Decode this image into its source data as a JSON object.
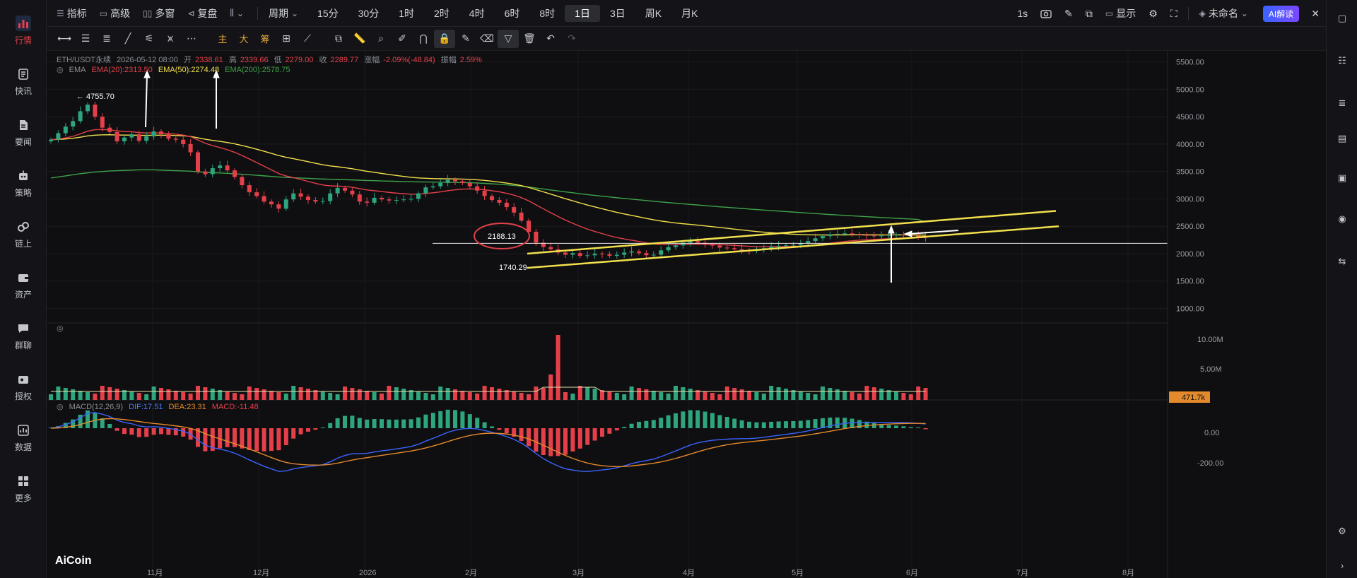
{
  "toolbar": {
    "indicators": "指标",
    "advanced": "高级",
    "multi_window": "多窗",
    "replay": "复盘",
    "period": "周期",
    "periods": [
      "15分",
      "30分",
      "1时",
      "2时",
      "4时",
      "6时",
      "8时",
      "1日",
      "3日",
      "周K",
      "月K"
    ],
    "active_period": "1日",
    "interval": "1s",
    "display": "显示",
    "layout_name": "未命名",
    "ai_button": "AI解读"
  },
  "drawing_tools": {
    "main": "主",
    "large": "大",
    "chips": "筹"
  },
  "sidebar": {
    "items": [
      {
        "label": "行情",
        "icon": "bar-chart-icon"
      },
      {
        "label": "快讯",
        "icon": "news-flash-icon"
      },
      {
        "label": "要闻",
        "icon": "document-icon"
      },
      {
        "label": "策略",
        "icon": "robot-icon"
      },
      {
        "label": "链上",
        "icon": "chain-icon"
      },
      {
        "label": "资产",
        "icon": "wallet-icon"
      },
      {
        "label": "群聊",
        "icon": "chat-icon"
      },
      {
        "label": "授权",
        "icon": "key-icon"
      },
      {
        "label": "数据",
        "icon": "data-icon"
      },
      {
        "label": "更多",
        "icon": "grid-icon"
      }
    ]
  },
  "ohlc": {
    "symbol": "ETH/USDT永续",
    "datetime": "2026-05-12 08:00",
    "open_label": "开",
    "open": "2338.61",
    "high_label": "高",
    "high": "2339.66",
    "low_label": "低",
    "low": "2279.00",
    "close_label": "收",
    "close": "2289.77",
    "change_label": "涨幅",
    "change": "-2.09%(-48.84)",
    "amp_label": "振幅",
    "amp": "2.59%"
  },
  "ema": {
    "label": "EMA",
    "ema20": "EMA(20):2313.50",
    "ema50": "EMA(50):2274.48",
    "ema200": "EMA(200):2578.75"
  },
  "macd": {
    "label": "MACD(12,26,9)",
    "dif": "DIF:17.51",
    "dea": "DEA:23.31",
    "macd": "MACD:-11.48"
  },
  "annotations": {
    "high_price": "← 4755.70",
    "circled_price": "2188.13",
    "low_price": "1740.29"
  },
  "volume_tag": "471.7k",
  "watermark": "AiCoin",
  "colors": {
    "up": "#2ea57d",
    "down": "#e5404a",
    "ema20": "#e5404a",
    "ema50": "#f2e04d",
    "ema200": "#3ea34a",
    "accent": "#3a63ff"
  },
  "chart_data": {
    "type": "candlestick",
    "x_labels": [
      "11月",
      "12月",
      "2026",
      "2月",
      "3月",
      "4月",
      "5月",
      "6月",
      "7月",
      "8月"
    ],
    "price_axis": [
      "5500.00",
      "5000.00",
      "4500.00",
      "4000.00",
      "3500.00",
      "3000.00",
      "2500.00",
      "2000.00",
      "1500.00",
      "1000.00"
    ],
    "volume_axis": [
      "10.00M",
      "5.00M"
    ],
    "macd_axis": [
      "0.00",
      "-200.00"
    ],
    "ylim": [
      800,
      5650
    ],
    "closes": [
      4080,
      4200,
      4320,
      4420,
      4600,
      4720,
      4500,
      4300,
      4220,
      4050,
      4120,
      4180,
      4060,
      4140,
      4230,
      4180,
      4100,
      4080,
      4000,
      3850,
      3500,
      3450,
      3560,
      3610,
      3520,
      3400,
      3250,
      3120,
      3050,
      2950,
      2900,
      2820,
      2990,
      3100,
      3040,
      2980,
      2950,
      2960,
      3100,
      3200,
      3150,
      3080,
      2950,
      2930,
      3020,
      2990,
      2970,
      2980,
      2990,
      3000,
      3100,
      3210,
      3230,
      3290,
      3350,
      3320,
      3290,
      3230,
      3150,
      3050,
      2980,
      2930,
      2850,
      2750,
      2600,
      2400,
      2200,
      2120,
      2080,
      2020,
      1980,
      2010,
      1960,
      1970,
      2000,
      1990,
      1960,
      1980,
      2020,
      2040,
      2010,
      1970,
      1980,
      2060,
      2120,
      2150,
      2200,
      2230,
      2200,
      2160,
      2150,
      2110,
      2100,
      2080,
      2060,
      2050,
      2070,
      2100,
      2130,
      2140,
      2150,
      2160,
      2190,
      2230,
      2280,
      2320,
      2350,
      2360,
      2370,
      2360,
      2340,
      2330,
      2320,
      2330,
      2340,
      2350,
      2340,
      2330,
      2310,
      2290
    ],
    "ema200": [
      3380,
      3400,
      3420,
      3440,
      3460,
      3475,
      3490,
      3500,
      3510,
      3515,
      3520,
      3525,
      3530,
      3530,
      3530,
      3525,
      3520,
      3515,
      3510,
      3505,
      3495,
      3485,
      3478,
      3472,
      3466,
      3458,
      3450,
      3440,
      3430,
      3420,
      3410,
      3400,
      3392,
      3386,
      3380,
      3374,
      3368,
      3362,
      3358,
      3354,
      3350,
      3346,
      3341,
      3336,
      3332,
      3328,
      3324,
      3320,
      3316,
      3313,
      3310,
      3308,
      3306,
      3305,
      3304,
      3302,
      3299,
      3295,
      3290,
      3283,
      3275,
      3266,
      3256,
      3245,
      3232,
      3216,
      3198,
      3180,
      3162,
      3145,
      3128,
      3111,
      3094,
      3078,
      3063,
      3049,
      3035,
      3021,
      3008,
      2995,
      2982,
      2969,
      2956,
      2944,
      2932,
      2921,
      2910,
      2899,
      2888,
      2877,
      2866,
      2855,
      2845,
      2835,
      2825,
      2815,
      2805,
      2795,
      2786,
      2777,
      2768,
      2759,
      2750,
      2741,
      2732,
      2723,
      2714,
      2706,
      2698,
      2690,
      2682,
      2674,
      2667,
      2660,
      2653,
      2646,
      2639,
      2632,
      2625,
      2578
    ],
    "trendlines": [
      {
        "from": [
          1740,
          "2月"
        ],
        "to": [
          2780,
          "7月"
        ]
      },
      {
        "from": [
          1740,
          "2月"
        ],
        "to": [
          2500,
          "7月"
        ]
      }
    ],
    "horizontal_line": 2188.13
  }
}
